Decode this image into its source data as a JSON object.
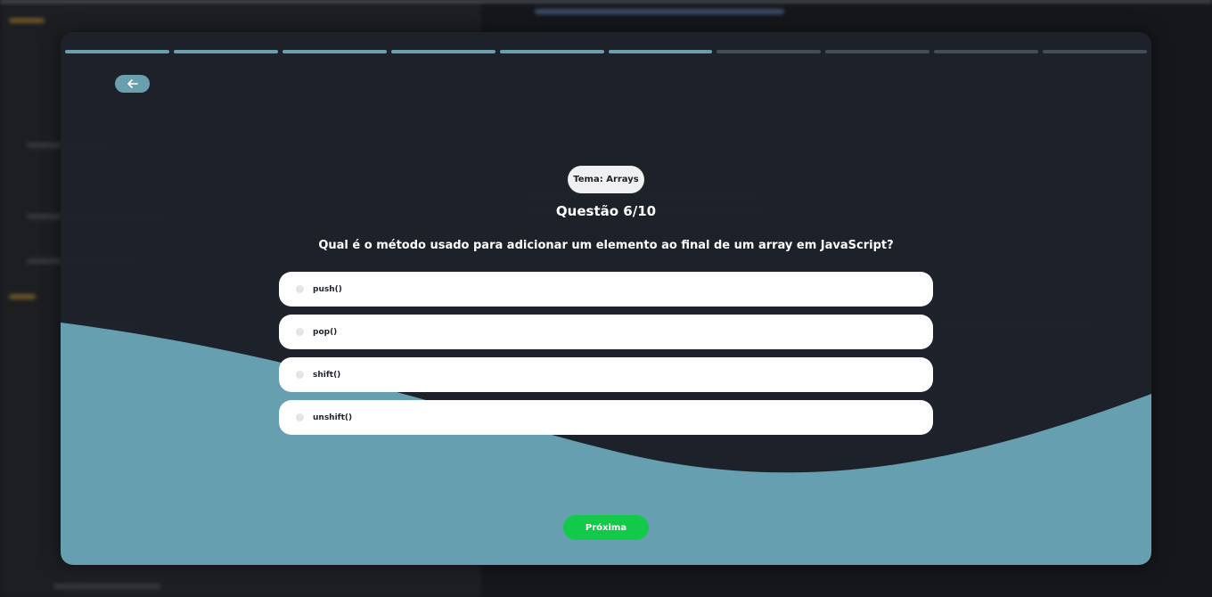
{
  "quiz": {
    "progress": {
      "current": 6,
      "total": 10
    },
    "topic_label": "Tema: Arrays",
    "question_number": "Questão 6/10",
    "question_text": "Qual é o método usado para adicionar um elemento ao final de um array em JavaScript?",
    "options": [
      {
        "label": "push()"
      },
      {
        "label": "pop()"
      },
      {
        "label": "shift()"
      },
      {
        "label": "unshift()"
      }
    ],
    "next_label": "Próxima",
    "back_icon": "arrow-left-icon"
  },
  "colors": {
    "accent": "#6a9fae",
    "card_background": "#1e222a",
    "next_button": "#12c94a",
    "progress_inactive": "#454c56"
  }
}
